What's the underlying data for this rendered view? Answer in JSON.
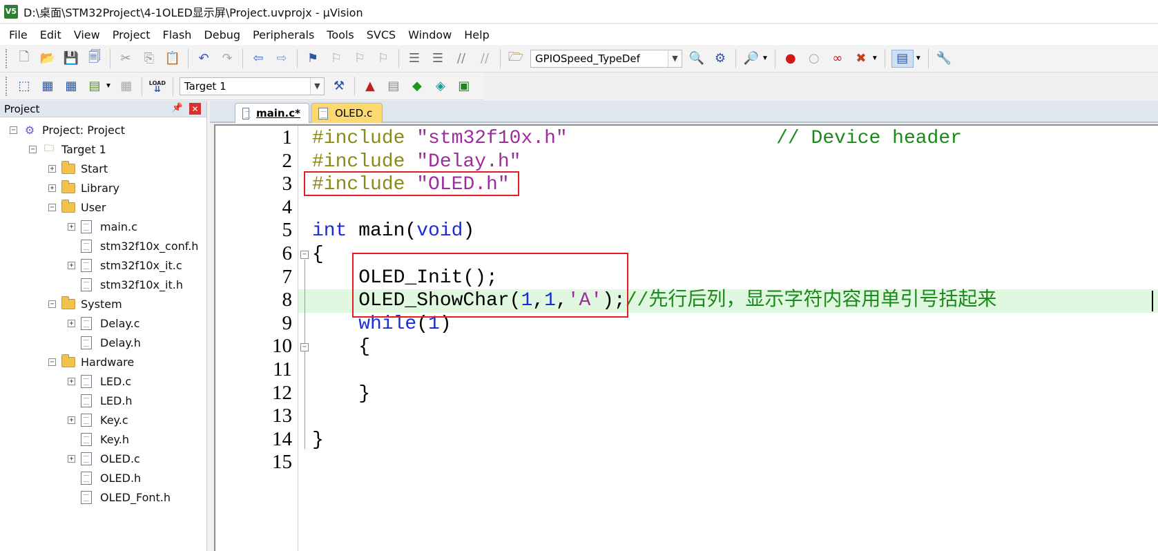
{
  "window": {
    "logo_text": "V5",
    "title": "D:\\桌面\\STM32Project\\4-1OLED显示屏\\Project.uvprojx - µVision"
  },
  "menu": [
    "File",
    "Edit",
    "View",
    "Project",
    "Flash",
    "Debug",
    "Peripherals",
    "Tools",
    "SVCS",
    "Window",
    "Help"
  ],
  "toolbar1": {
    "search_combo_value": "GPIOSpeed_TypeDef",
    "icons": [
      "new-file-icon",
      "open-file-icon",
      "save-icon",
      "save-all-icon",
      "cut-icon",
      "copy-icon",
      "paste-icon",
      "undo-icon",
      "redo-icon",
      "navigate-back-icon",
      "navigate-forward-icon",
      "bookmark-icon",
      "prev-bookmark-icon",
      "next-bookmark-icon",
      "clear-bookmarks-icon",
      "indent-icon",
      "unindent-icon",
      "comment-icon",
      "uncomment-icon",
      "find-in-files-icon",
      "find-icon",
      "incremental-find-icon",
      "debug-session-icon",
      "breakpoint-icon",
      "disable-breakpoint-icon",
      "disable-all-breakpoints-icon",
      "kill-all-breakpoints-icon",
      "window-layout-icon",
      "configure-icon"
    ]
  },
  "toolbar2": {
    "target_combo_value": "Target 1",
    "load_label": "LOAD",
    "icons": [
      "translate-icon",
      "build-icon",
      "rebuild-icon",
      "batch-build-icon",
      "stop-build-icon",
      "download-icon",
      "target-options-icon",
      "manage-components-icon",
      "select-packs-icon",
      "pack-installer-icon",
      "event-recorder-icon",
      "component-view-icon"
    ]
  },
  "project_panel": {
    "title": "Project",
    "tree": [
      {
        "label": "Project: Project",
        "level": 0,
        "type": "project",
        "expanded": true
      },
      {
        "label": "Target 1",
        "level": 1,
        "type": "target",
        "expanded": true
      },
      {
        "label": "Start",
        "level": 2,
        "type": "folder",
        "expanded": false
      },
      {
        "label": "Library",
        "level": 2,
        "type": "folder",
        "expanded": false
      },
      {
        "label": "User",
        "level": 2,
        "type": "folder",
        "expanded": true
      },
      {
        "label": "main.c",
        "level": 3,
        "type": "file",
        "expandable": true
      },
      {
        "label": "stm32f10x_conf.h",
        "level": 3,
        "type": "file",
        "expandable": false
      },
      {
        "label": "stm32f10x_it.c",
        "level": 3,
        "type": "file",
        "expandable": true
      },
      {
        "label": "stm32f10x_it.h",
        "level": 3,
        "type": "file",
        "expandable": false
      },
      {
        "label": "System",
        "level": 2,
        "type": "folder",
        "expanded": true
      },
      {
        "label": "Delay.c",
        "level": 3,
        "type": "file",
        "expandable": true
      },
      {
        "label": "Delay.h",
        "level": 3,
        "type": "file",
        "expandable": false
      },
      {
        "label": "Hardware",
        "level": 2,
        "type": "folder",
        "expanded": true
      },
      {
        "label": "LED.c",
        "level": 3,
        "type": "file",
        "expandable": true
      },
      {
        "label": "LED.h",
        "level": 3,
        "type": "file",
        "expandable": false
      },
      {
        "label": "Key.c",
        "level": 3,
        "type": "file",
        "expandable": true
      },
      {
        "label": "Key.h",
        "level": 3,
        "type": "file",
        "expandable": false
      },
      {
        "label": "OLED.c",
        "level": 3,
        "type": "file",
        "expandable": true
      },
      {
        "label": "OLED.h",
        "level": 3,
        "type": "file",
        "expandable": false
      },
      {
        "label": "OLED_Font.h",
        "level": 3,
        "type": "file",
        "expandable": false
      }
    ]
  },
  "tabs": [
    {
      "label": "main.c*",
      "active": true
    },
    {
      "label": "OLED.c",
      "active": false
    }
  ],
  "editor": {
    "highlight_color": "#e0f8e0",
    "annotation_color": "#e41b23",
    "lines": [
      {
        "num": "1",
        "tokens": [
          {
            "t": "#include ",
            "c": "pp"
          },
          {
            "t": "\"stm32f10x.h\"",
            "c": "str"
          },
          {
            "t": "                  ",
            "c": "plain"
          },
          {
            "t": "// Device header",
            "c": "cmt"
          }
        ]
      },
      {
        "num": "2",
        "tokens": [
          {
            "t": "#include ",
            "c": "pp"
          },
          {
            "t": "\"Delay.h\"",
            "c": "str"
          }
        ]
      },
      {
        "num": "3",
        "tokens": [
          {
            "t": "#include ",
            "c": "pp"
          },
          {
            "t": "\"OLED.h\"",
            "c": "str"
          }
        ]
      },
      {
        "num": "4",
        "tokens": []
      },
      {
        "num": "5",
        "tokens": [
          {
            "t": "int",
            "c": "kw"
          },
          {
            "t": " main(",
            "c": "plain"
          },
          {
            "t": "void",
            "c": "kw"
          },
          {
            "t": ")",
            "c": "plain"
          }
        ]
      },
      {
        "num": "6",
        "tokens": [
          {
            "t": "{",
            "c": "plain"
          }
        ]
      },
      {
        "num": "7",
        "tokens": [
          {
            "t": "    OLED_Init();",
            "c": "plain"
          }
        ]
      },
      {
        "num": "8",
        "tokens": [
          {
            "t": "    OLED_ShowChar(",
            "c": "plain"
          },
          {
            "t": "1",
            "c": "num"
          },
          {
            "t": ",",
            "c": "plain"
          },
          {
            "t": "1",
            "c": "num"
          },
          {
            "t": ",",
            "c": "plain"
          },
          {
            "t": "'A'",
            "c": "chr"
          },
          {
            "t": ");",
            "c": "plain"
          },
          {
            "t": "//先行后列，显示字符内容用单引号括起来",
            "c": "cmt"
          }
        ]
      },
      {
        "num": "9",
        "tokens": [
          {
            "t": "    ",
            "c": "plain"
          },
          {
            "t": "while",
            "c": "kw"
          },
          {
            "t": "(",
            "c": "plain"
          },
          {
            "t": "1",
            "c": "num"
          },
          {
            "t": ")",
            "c": "plain"
          }
        ]
      },
      {
        "num": "10",
        "tokens": [
          {
            "t": "    {",
            "c": "plain"
          }
        ]
      },
      {
        "num": "11",
        "tokens": []
      },
      {
        "num": "12",
        "tokens": [
          {
            "t": "    }",
            "c": "plain"
          }
        ]
      },
      {
        "num": "13",
        "tokens": []
      },
      {
        "num": "14",
        "tokens": [
          {
            "t": "}",
            "c": "plain"
          }
        ]
      },
      {
        "num": "15",
        "tokens": []
      }
    ],
    "highlighted_line": "8",
    "annotation_boxes": [
      "include-oled-box",
      "oled-calls-box"
    ]
  }
}
